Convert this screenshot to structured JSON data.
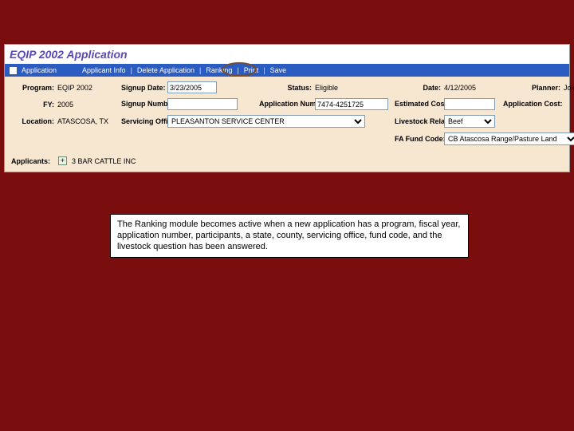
{
  "window": {
    "title": "EQIP 2002 Application"
  },
  "menu": {
    "application": "Application",
    "applicant_info": "Applicant Info",
    "delete_application": "Delete Application",
    "ranking": "Ranking",
    "print": "Print",
    "save": "Save"
  },
  "form": {
    "program_label": "Program:",
    "program_value": "EQIP 2002",
    "signup_date_label": "Signup Date:",
    "signup_date_value": "3/23/2005",
    "status_label": "Status:",
    "status_value": "Eligible",
    "date_label": "Date:",
    "date_value": "4/12/2005",
    "planner_label": "Planner:",
    "planner_value": "Jolene Smith",
    "fy_label": "FY:",
    "fy_value": "2005",
    "signup_number_label": "Signup Number:",
    "signup_number_value": "",
    "app_number_label": "Application Number:",
    "app_number_value": "7474-4251725",
    "est_cost_label": "Estimated Cost:",
    "est_cost_value": "",
    "app_cost_label": "Application Cost:",
    "location_label": "Location:",
    "location_value": "ATASCOSA, TX",
    "servicing_office_label": "Servicing Office:",
    "servicing_office_value": "PLEASANTON SERVICE CENTER",
    "livestock_label": "Livestock Related:",
    "livestock_value": "Beef",
    "fund_code_label": "FA Fund Code:",
    "fund_code_value": "CB Atascosa Range/Pasture Land",
    "applicants_label": "Applicants:",
    "applicants_value": "3 BAR CATTLE INC"
  },
  "caption": "The Ranking module becomes active when a new application has a program, fiscal year, application number, participants, a state, county, servicing office, fund code, and the livestock question has been answered."
}
